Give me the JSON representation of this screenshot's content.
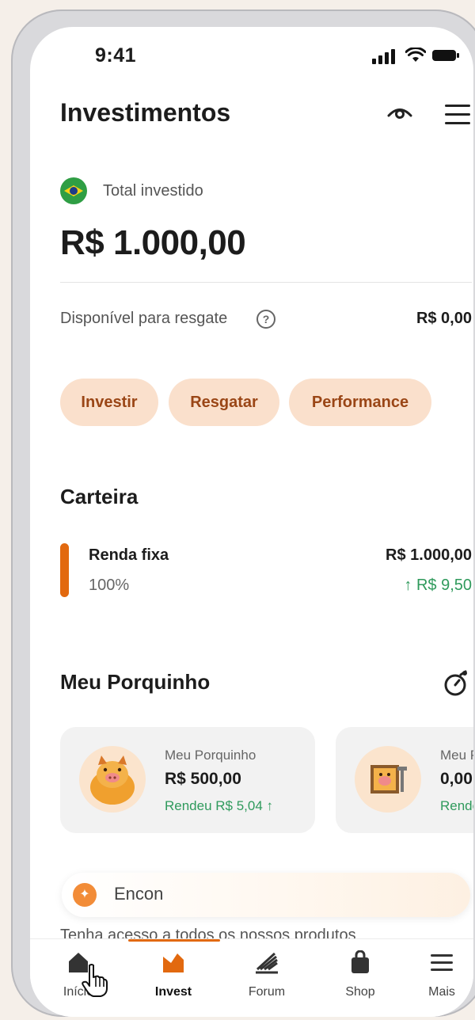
{
  "status_bar": {
    "time": "9:41"
  },
  "header": {
    "title": "Investimentos"
  },
  "summary": {
    "total_label": "Total investido",
    "total_value": "R$ 1.000,00",
    "available_label": "Disponível para resgate",
    "help_icon": "?",
    "available_value": "R$ 0,00"
  },
  "actions": [
    "Investir",
    "Resgatar",
    "Performance"
  ],
  "portfolio": {
    "title": "Carteira",
    "item": {
      "name": "Renda fixa",
      "percent": "100%",
      "value": "R$ 1.000,00",
      "gain": "↑ R$ 9,50"
    },
    "bar_color": "#e2690f"
  },
  "piggy": {
    "title": "Meu Porquinho",
    "cards": [
      {
        "label": "Meu Porquinho",
        "value": "R$ 500,00",
        "gain": "Rendeu R$ 5,04 ↑"
      },
      {
        "label": "Meu Po",
        "value": "0,00",
        "gain": "Rende"
      }
    ]
  },
  "search": {
    "text": "Encon"
  },
  "promo_text": "Tenha acesso a todos os nossos produtos",
  "bottom_nav": {
    "tabs": [
      {
        "label": "Início",
        "icon": "home-icon"
      },
      {
        "label": "Invest",
        "icon": "invest-icon"
      },
      {
        "label": "Forum",
        "icon": "forum-icon"
      },
      {
        "label": "Shop",
        "icon": "shop-bag-icon"
      },
      {
        "label": "Mais",
        "icon": "menu-icon"
      }
    ]
  },
  "colors": {
    "accent": "#e2690f",
    "pill_bg": "#fae0cc",
    "pill_text": "#9a4616",
    "gain": "#2f9a5c"
  }
}
